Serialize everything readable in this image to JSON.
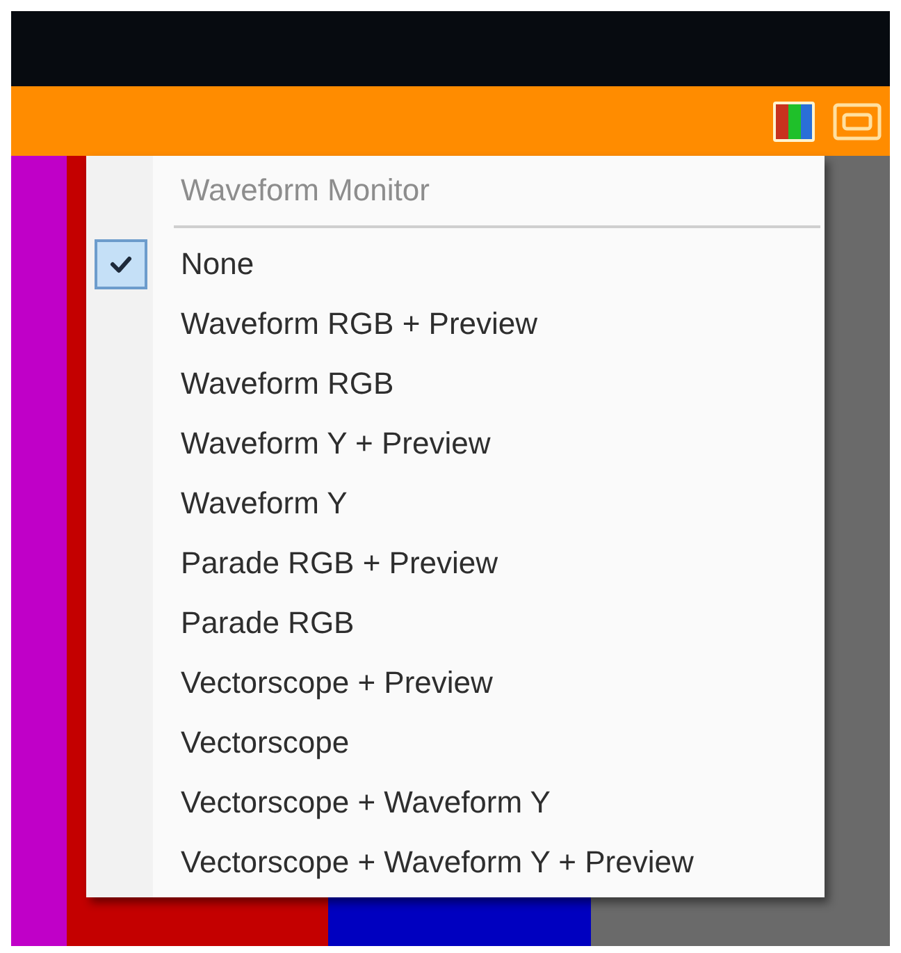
{
  "menu": {
    "title": "Waveform Monitor",
    "items": [
      {
        "label": "None",
        "selected": true
      },
      {
        "label": "Waveform RGB + Preview",
        "selected": false
      },
      {
        "label": "Waveform RGB",
        "selected": false
      },
      {
        "label": "Waveform Y + Preview",
        "selected": false
      },
      {
        "label": "Waveform Y",
        "selected": false
      },
      {
        "label": "Parade RGB + Preview",
        "selected": false
      },
      {
        "label": "Parade RGB",
        "selected": false
      },
      {
        "label": "Vectorscope + Preview",
        "selected": false
      },
      {
        "label": "Vectorscope",
        "selected": false
      },
      {
        "label": "Vectorscope + Waveform Y",
        "selected": false
      },
      {
        "label": "Vectorscope + Waveform Y + Preview",
        "selected": false
      }
    ]
  }
}
